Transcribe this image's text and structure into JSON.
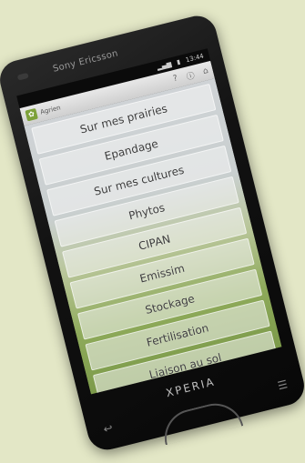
{
  "phone": {
    "brand": "Sony Ericsson",
    "model": "XPERIA",
    "status_time": "13:44"
  },
  "app": {
    "title": "Agrien",
    "icon": "app-leaf-icon",
    "help_icon": "?",
    "items": [
      {
        "label": "Sur mes prairies"
      },
      {
        "label": "Epandage"
      },
      {
        "label": "Sur mes cultures"
      },
      {
        "label": "Phytos"
      },
      {
        "label": "CIPAN"
      },
      {
        "label": "Emissim"
      },
      {
        "label": "Stockage"
      },
      {
        "label": "Fertilisation"
      },
      {
        "label": "Liaison au sol"
      }
    ]
  },
  "colors": {
    "background": "#e3e7c6",
    "menu_green": "#8eaa5a"
  }
}
